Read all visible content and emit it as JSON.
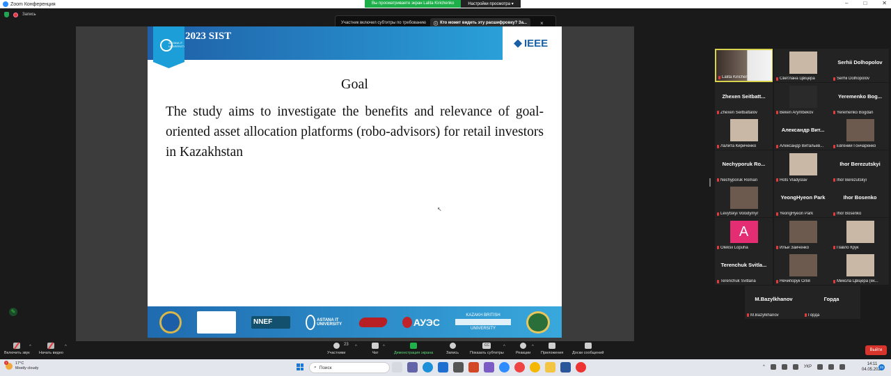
{
  "window": {
    "title": "Zoom Конференция",
    "controls": [
      "–",
      "□",
      "✕"
    ]
  },
  "share_banner": {
    "viewing": "Вы просматриваете экран Lalita Kirichenko",
    "options": "Настройки просмотра ▾"
  },
  "topbar": {
    "recording": "Запись"
  },
  "caption_notice": {
    "text": "Участник включил субтитры по требованию",
    "button": "Кто может видеть эту расшифровку? За...",
    "close": "×"
  },
  "slide": {
    "conference": "2023 SIST",
    "logo_text": "ASTANA IT UNIVERSITY",
    "ieee": "IEEE",
    "heading": "Goal",
    "body": "The study aims to investigate the benefits and relevance of goal-oriented asset allocation platforms (robo-advisors) for retail investors in Kazakhstan",
    "footer": {
      "nnef": "NNEF",
      "astana": "ASTANA IT UNIVERSITY",
      "auez": "АУЭС",
      "kbtu_top": "KAZAKH BRITISH",
      "kbtu_bottom": "UNIVERSITY"
    }
  },
  "participants": [
    {
      "label": "Lalita Kirichenko",
      "big": "",
      "photo": "wide",
      "active": true
    },
    {
      "label": "Светлана Цвіцера",
      "big": "",
      "photo": "light"
    },
    {
      "label": "Serhii Dolhopolov",
      "big": "Serhii Dolhopolov"
    },
    {
      "label": "Zhexen Seitbattalov",
      "big": "Zhexen Seitbatt..."
    },
    {
      "label": "Beken Arymbekov",
      "big": "",
      "photo": "dark"
    },
    {
      "label": "Yeremenko Bogdan",
      "big": "Yeremenko Bog..."
    },
    {
      "label": "Лалита Кириченко",
      "big": "",
      "photo": "light"
    },
    {
      "label": "Александр Витальев...",
      "big": "Александр Вит..."
    },
    {
      "label": "Евгений Гончаренко",
      "big": "",
      "photo": "normal"
    },
    {
      "label": "Nechyporuk Roman",
      "big": "Nechyporuk Ro..."
    },
    {
      "label": "Hots Vladyslav",
      "big": "",
      "photo": "light"
    },
    {
      "label": "Ihor Berezutskyi",
      "big": "Ihor Berezutskyi"
    },
    {
      "label": "Levytskyi Volodymyr",
      "big": "",
      "photo": "normal"
    },
    {
      "label": "YeongHyeon Park",
      "big": "YeongHyeon Park"
    },
    {
      "label": "Ihor Bosenko",
      "big": "Ihor Bosenko"
    },
    {
      "label": "Oleksii Lopuha",
      "big": "",
      "photo": "pink",
      "initial": "A"
    },
    {
      "label": "Ильи Зайченко",
      "big": "",
      "photo": "normal"
    },
    {
      "label": "Павло Крук",
      "big": "",
      "photo": "light"
    },
    {
      "label": "Terenchuk Svitlana",
      "big": "Terenchuk Svitla..."
    },
    {
      "label": "Нечипорук Олія",
      "big": "",
      "photo": "normal"
    },
    {
      "label": "Микола Цвіцера (ек...",
      "big": "",
      "photo": "light"
    },
    {
      "label": "M.Bazylkhanov",
      "big": "M.Bazylkhanov"
    },
    {
      "label": "Горда",
      "big": "Горда"
    }
  ],
  "toolbar": {
    "unmute": "Включить звук",
    "video": "Начать видео",
    "participants": "Участники",
    "participants_count": "23",
    "chat": "Чат",
    "share": "Демонстрация экрана",
    "record": "Запись",
    "captions": "Показать субтитры",
    "captions_icon": "CC",
    "reactions": "Реакции",
    "apps": "Приложения",
    "whiteboard": "Доски сообщений",
    "leave": "Выйти"
  },
  "taskbar": {
    "temp": "17°C",
    "weather": "Mostly cloudy",
    "weather_badge": "1",
    "search": "Поиск",
    "lang": "УКР",
    "time": "14:11",
    "date": "04.05.2023",
    "notifications": "23"
  }
}
